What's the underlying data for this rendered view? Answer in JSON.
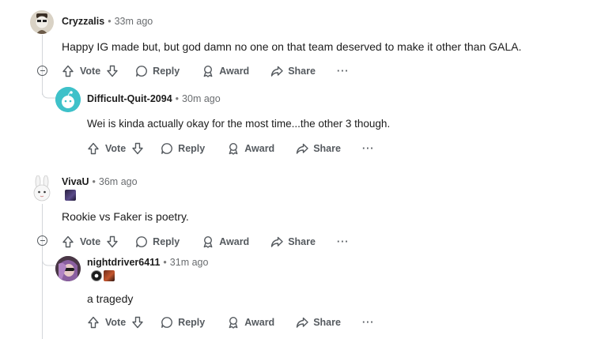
{
  "actions": {
    "vote": "Vote",
    "reply": "Reply",
    "award": "Award",
    "share": "Share",
    "more": "···"
  },
  "comments": [
    {
      "author": "Cryzzalis",
      "time": "33m ago",
      "body": "Happy IG made but, but god damn no one on that team deserved to make it other than GALA."
    },
    {
      "author": "Difficult-Quit-2094",
      "time": "30m ago",
      "body": "Wei is kinda actually okay for the most time...the other 3 though."
    },
    {
      "author": "VivaU",
      "time": "36m ago",
      "body": "Rookie vs Faker is poetry."
    },
    {
      "author": "nightdriver6411",
      "time": "31m ago",
      "body": "a tragedy"
    }
  ],
  "colors": {
    "text": "#1c1c1c",
    "meta": "#6a6d70",
    "action": "#555a5f",
    "thread_line": "#d3d6da",
    "snoo_avatar_bg": "#3ec1c9"
  },
  "separator": "•"
}
